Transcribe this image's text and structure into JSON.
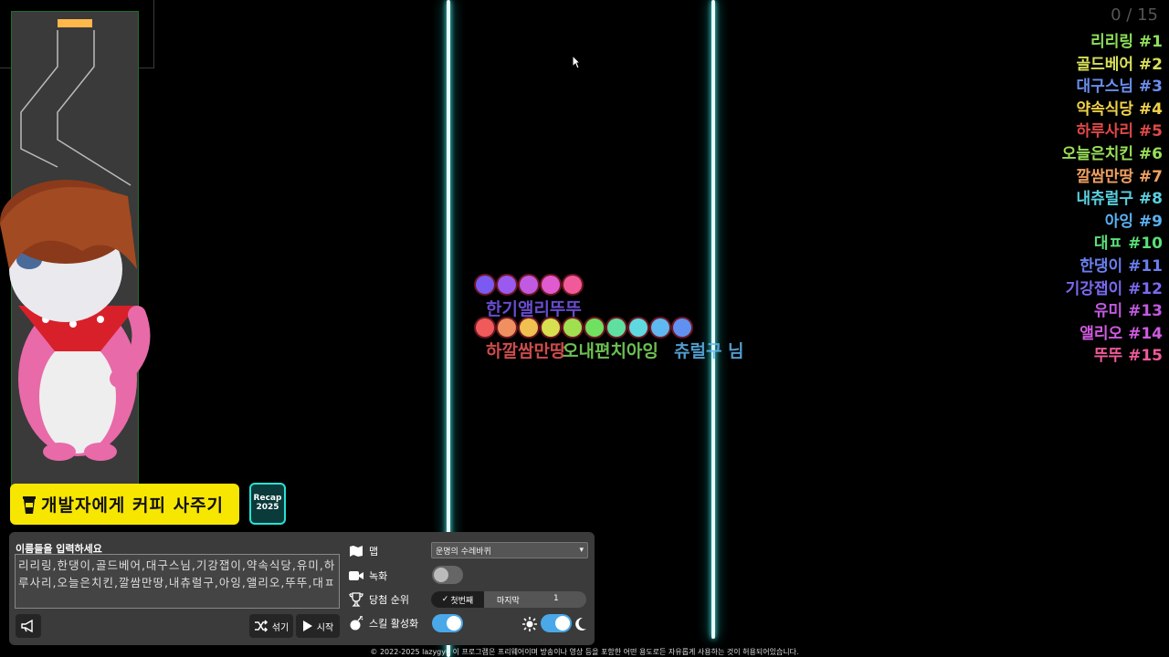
{
  "counter": "0 / 15",
  "ranking": [
    {
      "text": "리리링 #1",
      "color": "#8ee05a"
    },
    {
      "text": "골드베어 #2",
      "color": "#d7e05a"
    },
    {
      "text": "대구스님 #3",
      "color": "#6a8ef0"
    },
    {
      "text": "약속식당 #4",
      "color": "#f0d24a"
    },
    {
      "text": "하루사리 #5",
      "color": "#e04848"
    },
    {
      "text": "오늘은치킨 #6",
      "color": "#9ae05a"
    },
    {
      "text": "깔쌈만땅 #7",
      "color": "#f0a060"
    },
    {
      "text": "내츄럴구 #8",
      "color": "#5ad0e0"
    },
    {
      "text": "아잉 #9",
      "color": "#5ab0f0"
    },
    {
      "text": "대ㅍ #10",
      "color": "#5ae07a"
    },
    {
      "text": "한댕이 #11",
      "color": "#6a7ef0"
    },
    {
      "text": "기강잽이 #12",
      "color": "#7a6af0"
    },
    {
      "text": "유미 #13",
      "color": "#c05ae0"
    },
    {
      "text": "앨리오 #14",
      "color": "#d05ae0"
    },
    {
      "text": "뚜뚜 #15",
      "color": "#f05a9a"
    }
  ],
  "marbles_row1": [
    "#7a5af0",
    "#9a5af0",
    "#c05ae0",
    "#e05ad0",
    "#f05a9a"
  ],
  "marbles_row2": [
    "#f05a5a",
    "#f09060",
    "#f0c050",
    "#d8e050",
    "#a0e050",
    "#70e060",
    "#60e0a0",
    "#60d8e0",
    "#60b8f0",
    "#6090f0"
  ],
  "marble_labels": {
    "row1": "한기앨리뚜뚜",
    "row2a": "하깔쌈만땅",
    "row2b": "오내편치아잉",
    "row2c": "츄럴구 님"
  },
  "coffee_button": "개발자에게 커피 사주기",
  "recap": {
    "line1": "Recap",
    "line2": "2025"
  },
  "panel": {
    "names_label": "이름들을 입력하세요",
    "names_value": "리리링,한댕이,골드베어,대구스님,기강잽이,약속식당,유미,하루사리,오늘은치킨,깔쌈만땅,내츄럴구,아잉,앨리오,뚜뚜,대ㅍ",
    "shuffle_label": "섞기",
    "start_label": "시작",
    "map_label": "맵",
    "map_value": "운명의 수레바퀴",
    "record_label": "녹화",
    "winning_rank_label": "당첨 순위",
    "rank_first": "첫번째",
    "rank_last": "마지막",
    "rank_number": "1",
    "skill_label": "스킬 활성화",
    "accent": "#4aa8e8"
  },
  "footer": "© 2022-2025 lazygyu 이 프로그램은 프리웨어이며 방송이나 영상 등을 포함한 어떤 용도로든 자유롭게 사용하는 것이 허용되어있습니다."
}
